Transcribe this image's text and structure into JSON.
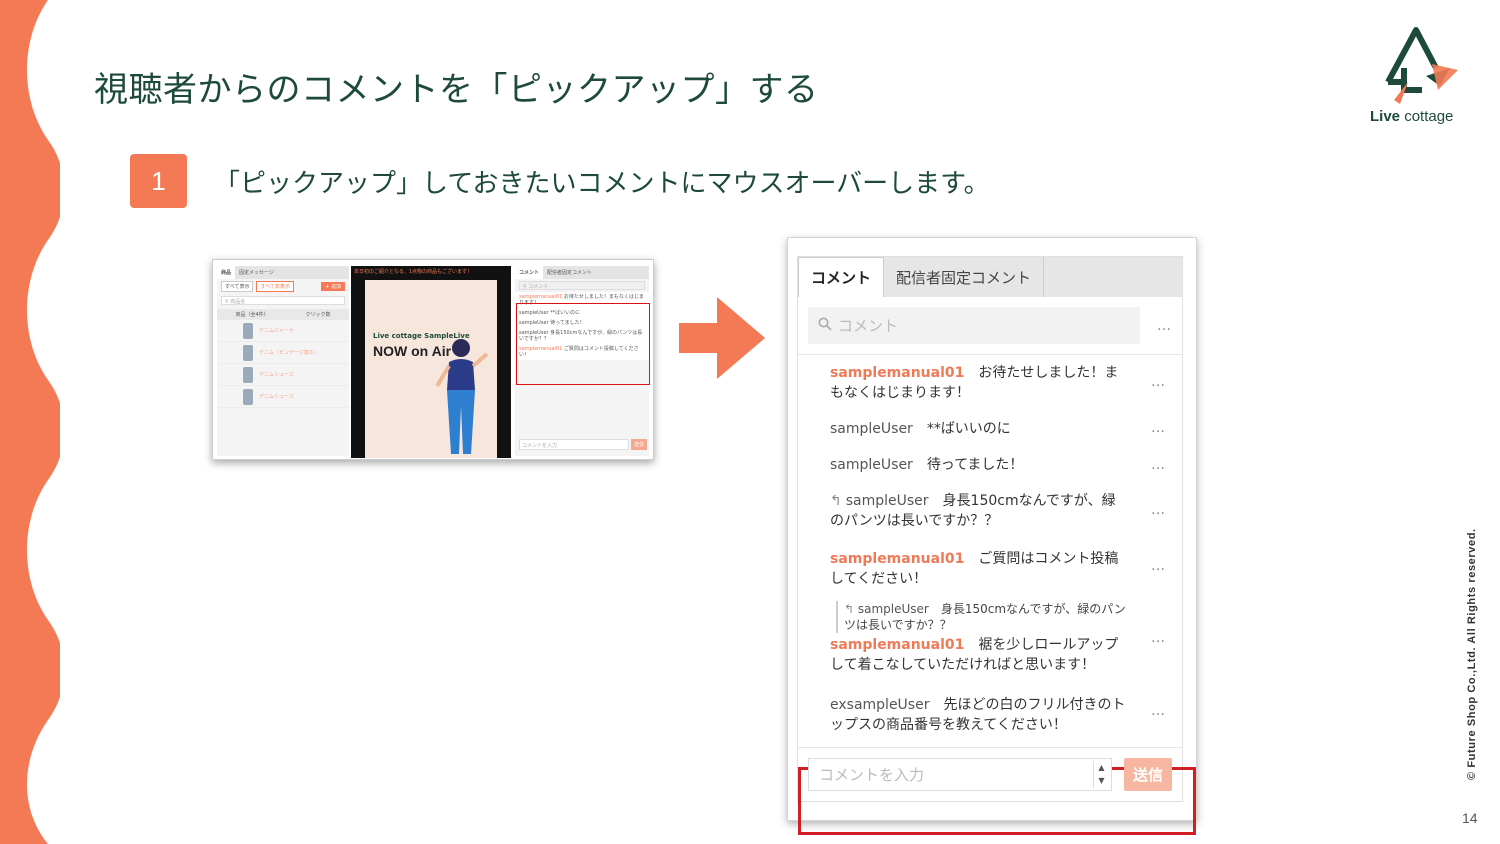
{
  "slide": {
    "title": "視聴者からのコメントを「ピックアップ」する",
    "step_number": "1",
    "step_text": "「ピックアップ」しておきたいコメントにマウスオーバーします。",
    "copyright": "© Future Shop Co.,Ltd. All Rights reserved.",
    "page_number": "14"
  },
  "logo": {
    "text_bold": "Live",
    "text_regular": "cottage"
  },
  "mini_screenshot": {
    "left_tabs": [
      "商品",
      "固定メッセージ"
    ],
    "filter_buttons": [
      "すべて表示",
      "すべて非表示"
    ],
    "add_button": "+ 追加",
    "search_placeholder": "商品名",
    "columns": [
      "商品（全4件）",
      "クリック数"
    ],
    "products": [
      "デニムジャーナ",
      "デニム（ビンテージ加工）",
      "デニムシューズ",
      "デニムシューズ"
    ],
    "banner": "本日初のご紹介となる、1点物の商品もございます！",
    "live_title": "Live cottage SampleLive",
    "now_on_air": "NOW on Air",
    "right_tabs": [
      "コメント",
      "配信者固定コメント"
    ],
    "comment_placeholder": "コメント",
    "comments": [
      {
        "user": "samplemanual01",
        "text": "お待たせしました！まもなくはじまります！",
        "staff": true
      },
      {
        "user": "sampleUser",
        "text": "**ばいいのに",
        "staff": false
      },
      {
        "user": "sampleUser",
        "text": "待ってました！",
        "staff": false
      },
      {
        "user": "sampleUser",
        "text": "身長150cmなんですが、緑のパンツは長いですか？？",
        "staff": false
      },
      {
        "user": "samplemanual01",
        "text": "ご質問はコメント投稿してください！",
        "staff": true
      }
    ],
    "input_placeholder": "コメントを入力",
    "send": "送信"
  },
  "panel": {
    "tabs": [
      "コメント",
      "配信者固定コメント"
    ],
    "search_placeholder": "コメント",
    "more_dots": "…",
    "comments": [
      {
        "user": "samplemanual01",
        "text": "お待たせしました！まもなくはじまります！"
      },
      {
        "user": "sampleUser",
        "text": "**ばいいのに"
      },
      {
        "user": "sampleUser",
        "text": "待ってました！"
      },
      {
        "user": "sampleUser",
        "text": "身長150cmなんですが、緑のパンツは長いですか？？"
      },
      {
        "user": "samplemanual01",
        "text": "ご質問はコメント投稿してください！"
      },
      {
        "quote_user": "sampleUser",
        "quote_text": "身長150cmなんですが、緑のパンツは長いですか？？",
        "user": "samplemanual01",
        "text": "裾を少しロールアップして着こなしていただければと思います！"
      },
      {
        "user": "exsampleUser",
        "text": "先ほどの白のフリル付きのトップスの商品番号を教えてください！"
      }
    ],
    "input_placeholder": "コメントを入力",
    "send": "送信"
  },
  "colors": {
    "accent": "#f47a55",
    "title": "#1d4a3b",
    "highlight": "#d11f25"
  }
}
